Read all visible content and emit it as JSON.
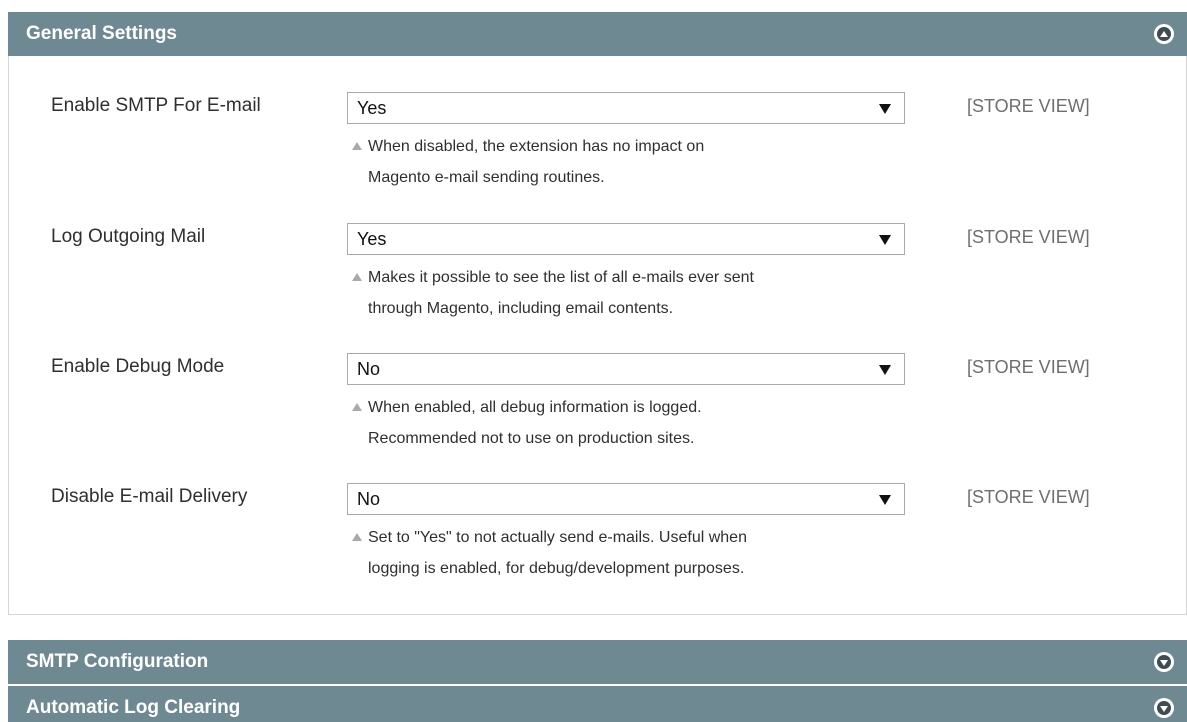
{
  "sections": {
    "general": {
      "title": "General Settings",
      "state": "expanded"
    },
    "smtp": {
      "title": "SMTP Configuration",
      "state": "collapsed"
    },
    "log_clearing": {
      "title": "Automatic Log Clearing",
      "state": "collapsed"
    }
  },
  "fields": [
    {
      "label": "Enable SMTP For E-mail",
      "value": "Yes",
      "scope": "[STORE VIEW]",
      "note_line1": "When disabled, the extension has no impact on",
      "note_line2": "Magento e-mail sending routines."
    },
    {
      "label": "Log Outgoing Mail",
      "value": "Yes",
      "scope": "[STORE VIEW]",
      "note_line1": "Makes it possible to see the list of all e-mails ever sent",
      "note_line2": "through Magento, including email contents."
    },
    {
      "label": "Enable Debug Mode",
      "value": "No",
      "scope": "[STORE VIEW]",
      "note_line1": "When enabled, all debug information is logged.",
      "note_line2": "Recommended not to use on production sites."
    },
    {
      "label": "Disable E-mail Delivery",
      "value": "No",
      "scope": "[STORE VIEW]",
      "note_line1": "Set to \"Yes\" to not actually send e-mails. Useful when",
      "note_line2": "logging is enabled, for debug/development purposes."
    }
  ],
  "colors": {
    "header_bg": "#6f8992",
    "header_text": "#ffffff",
    "scope_text": "#6e6e6e"
  },
  "icons": {
    "expanded": "collapse-up-icon",
    "collapsed": "expand-down-icon",
    "note": "note-triangle-icon",
    "select": "dropdown-arrow-icon"
  }
}
